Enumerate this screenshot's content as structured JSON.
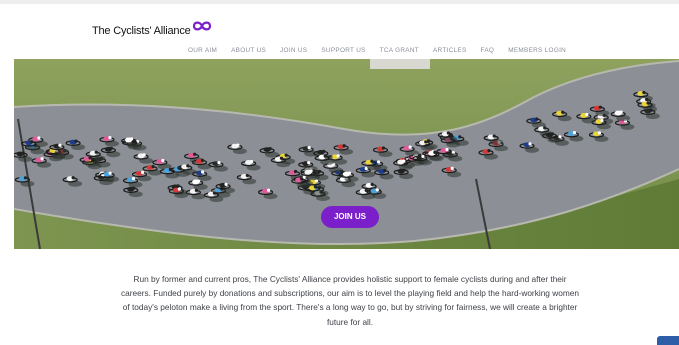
{
  "site": {
    "logo_text": "The Cyclists' Alliance",
    "brand_color": "#7a1fc9"
  },
  "nav": {
    "items": [
      {
        "label": "OUR AIM"
      },
      {
        "label": "ABOUT US"
      },
      {
        "label": "JOIN US"
      },
      {
        "label": "SUPPORT US"
      },
      {
        "label": "TCA GRANT"
      },
      {
        "label": "ARTICLES"
      },
      {
        "label": "FAQ"
      },
      {
        "label": "MEMBERS LOGIN"
      }
    ]
  },
  "hero": {
    "image": "aerial photo of a women's cycling peloton on a curved road through green grass",
    "cta_label": "JOIN US"
  },
  "intro": {
    "text": "Run by former and current pros, The Cyclists' Alliance provides holistic support to female cyclists during and after their careers. Funded purely by donations and subscriptions, our aim is to level the playing field and help the hard-working women of today's peloton make a living from the sport. There's a long way to go, but by striving for fairness, we will create a brighter future for all."
  },
  "icons": {
    "logo_mark": "infinity-loop-icon",
    "chat": "chat-icon"
  }
}
